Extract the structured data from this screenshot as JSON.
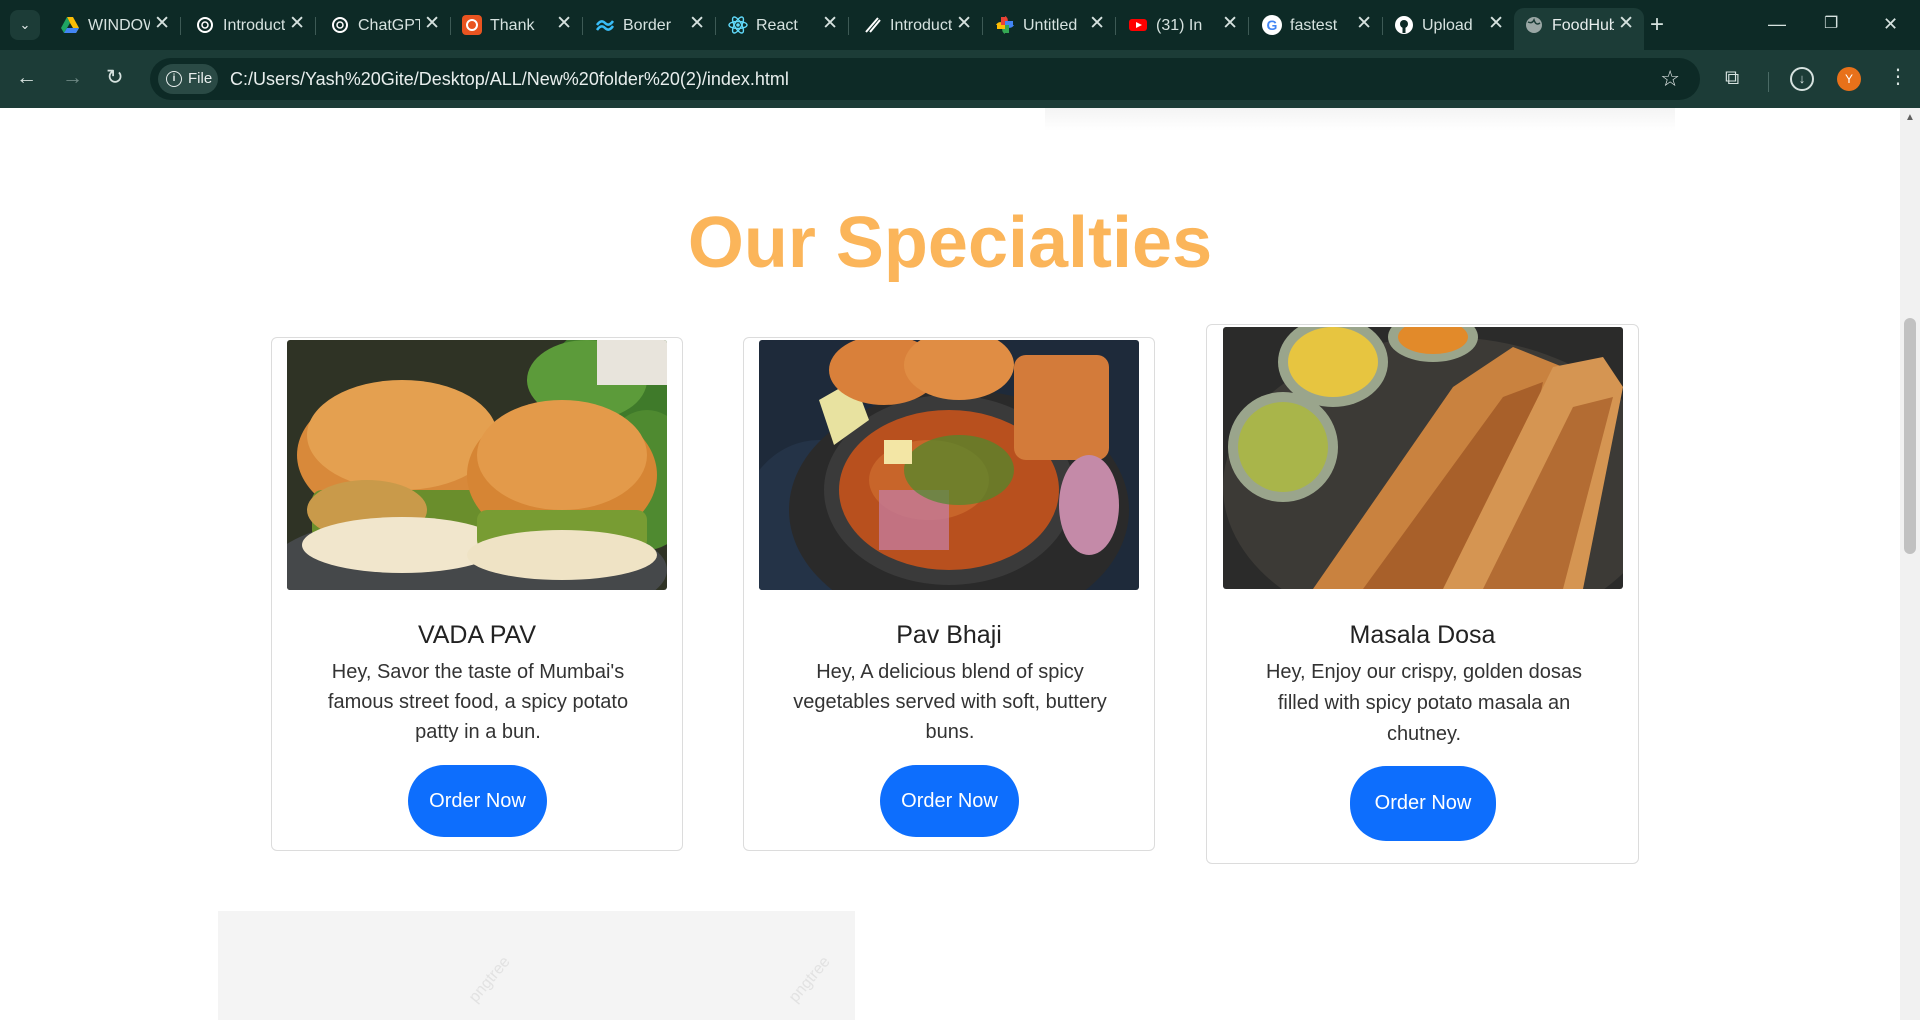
{
  "browser": {
    "tabs": [
      {
        "title": "WINDOWS",
        "icon": "google-drive-icon",
        "color": "#1fa463"
      },
      {
        "title": "Introduction",
        "icon": "openai-icon",
        "color": "#ffffff"
      },
      {
        "title": "ChatGPT",
        "icon": "openai-icon",
        "color": "#ffffff"
      },
      {
        "title": "Thank",
        "icon": "ubuntu-icon",
        "color": "#e95420"
      },
      {
        "title": "Border",
        "icon": "tailwind-icon",
        "color": "#38bdf8"
      },
      {
        "title": "React",
        "icon": "react-icon",
        "color": "#61dafb"
      },
      {
        "title": "Introduction",
        "icon": "slash-icon",
        "color": "#ffffff"
      },
      {
        "title": "Untitled",
        "icon": "pinwheel-icon",
        "color": "#fbbc05"
      },
      {
        "title": "(31) In",
        "icon": "youtube-icon",
        "color": "#ff0000"
      },
      {
        "title": "fastest",
        "icon": "google-icon",
        "color": "#4285f4"
      },
      {
        "title": "Upload",
        "icon": "github-icon",
        "color": "#ffffff"
      },
      {
        "title": "FoodHub",
        "icon": "globe-icon",
        "color": "#9aa7a5"
      }
    ],
    "close_glyph": "✕",
    "new_tab_glyph": "+",
    "security_chip": "File",
    "url": "C:/Users/Yash%20Gite/Desktop/ALL/New%20folder%20(2)/index.html",
    "profile_initial": "Y"
  },
  "page": {
    "section_title": "Our Specialties",
    "cards": [
      {
        "name": "VADA PAV",
        "description": "Hey, Savor the taste of Mumbai's famous street food, a spicy potato patty in a bun.",
        "button": "Order Now",
        "image": "vada-pav-image"
      },
      {
        "name": "Pav Bhaji",
        "description": "Hey, A delicious blend of spicy vegetables served with soft, buttery buns.",
        "button": "Order Now",
        "image": "pav-bhaji-image"
      },
      {
        "name": "Masala Dosa",
        "description": "Hey, Enjoy our crispy, golden dosas filled with spicy potato masala an chutney.",
        "button": "Order Now",
        "image": "masala-dosa-image"
      }
    ],
    "watermark": "pngtree"
  },
  "colors": {
    "title_accent": "#fbb55a",
    "button": "#0d6efd",
    "chrome_dark": "#0d2a26",
    "chrome_toolbar": "#1c3c37"
  }
}
